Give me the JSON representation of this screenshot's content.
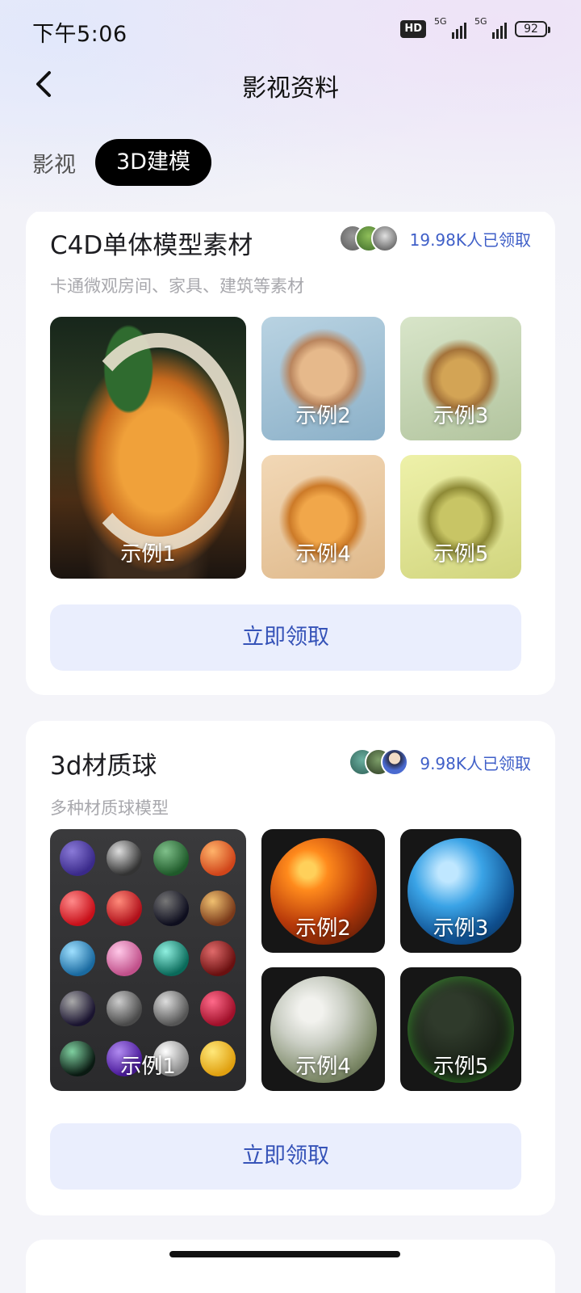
{
  "status_bar": {
    "time": "下午5:06",
    "hd_label": "HD",
    "network_1": "5G",
    "network_2": "5G",
    "battery": "92"
  },
  "header": {
    "back_icon": "chevron-left-icon",
    "title": "影视资料"
  },
  "tabs": [
    {
      "label": "影视",
      "active": false
    },
    {
      "label": "3D建模",
      "active": true
    }
  ],
  "cards": [
    {
      "title": "C4D单体模型素材",
      "subtitle": "卡通微观房间、家具、建筑等素材",
      "claim_count": "19.98K人已领取",
      "samples": [
        "示例1",
        "示例2",
        "示例3",
        "示例4",
        "示例5"
      ],
      "button": "立即领取"
    },
    {
      "title": "3d材质球",
      "subtitle": "多种材质球模型",
      "claim_count": "9.98K人已领取",
      "samples": [
        "示例1",
        "示例2",
        "示例3",
        "示例4",
        "示例5"
      ],
      "button": "立即领取"
    }
  ],
  "colors": {
    "accent_text": "#3f5fc8",
    "button_bg": "#eaeefd",
    "button_text": "#3653b8",
    "active_tab_bg": "#000000"
  }
}
